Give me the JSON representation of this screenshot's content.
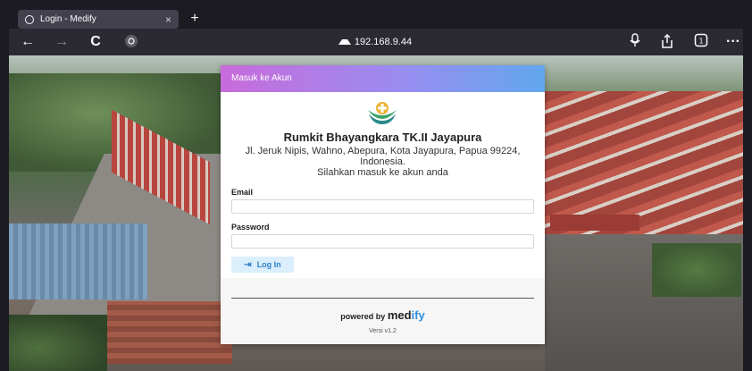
{
  "browser": {
    "tab_title": "Login - Medify",
    "tab_close": "×",
    "new_tab": "+",
    "url": "192.168.9.44",
    "back": "←",
    "forward": "→",
    "reload": "C",
    "more": "···"
  },
  "card": {
    "header": "Masuk ke Akun",
    "org_name": "Rumkit Bhayangkara TK.II Jayapura",
    "address": "Jl. Jeruk Nipis, Wahno, Abepura, Kota Jayapura, Papua 99224, Indonesia.",
    "subtitle": "Silahkan masuk ke akun anda",
    "email_label": "Email",
    "password_label": "Password",
    "login_button": "Log In",
    "powered_by": "powered by",
    "brand_prefix": "med",
    "brand_suffix": "ify",
    "version": "Versi v1.2"
  },
  "colors": {
    "header_gradient_start": "#c86bdb",
    "header_gradient_end": "#62a8ee",
    "login_button_bg": "#dbeefc",
    "brand_accent": "#2f8fe0"
  }
}
